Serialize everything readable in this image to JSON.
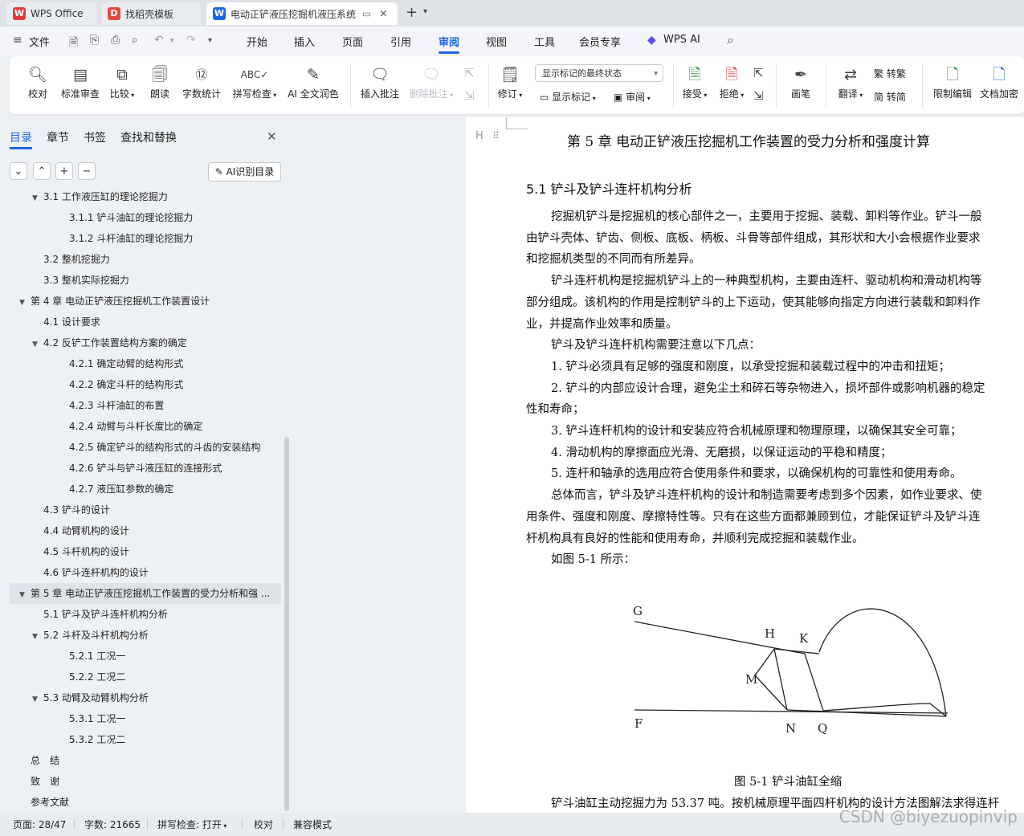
{
  "tabs": {
    "wps_office": "WPS Office",
    "template": "找稻壳模板",
    "document": "电动正铲液压挖掘机液压系统"
  },
  "menu": {
    "file": "文件",
    "items": [
      "开始",
      "插入",
      "页面",
      "引用",
      "审阅",
      "视图",
      "工具",
      "会员专享"
    ],
    "wps_ai": "WPS AI"
  },
  "ribbon": {
    "proofread": "校对",
    "standard_review": "标准审查",
    "compare": "比较",
    "read_aloud": "朗读",
    "word_count": "字数统计",
    "spell_check": "拼写检查",
    "ai_polish": "AI 全文润色",
    "insert_comment": "插入批注",
    "delete_comment": "删除批注",
    "revise": "修订",
    "markup_mode": "显示标记的最终状态",
    "show_markup": "显示标记",
    "review": "审阅",
    "accept": "接受",
    "reject": "拒绝",
    "pen": "画笔",
    "translate": "翻译",
    "to_traditional": "转繁",
    "to_simplified": "转简",
    "restrict_edit": "限制编辑",
    "doc_encrypt": "文档加密"
  },
  "sidebar": {
    "tabs": [
      "目录",
      "章节",
      "书签",
      "查找和替换"
    ],
    "ai_toc": "AI识别目录",
    "toc": [
      {
        "label": "3.1 工作液压缸的理论挖掘力",
        "level": 2,
        "arrow": "▾"
      },
      {
        "label": "3.1.1 铲斗油缸的理论挖掘力",
        "level": 3
      },
      {
        "label": "3.1.2 斗杆油缸的理论挖掘力",
        "level": 3
      },
      {
        "label": "3.2 整机挖掘力",
        "level": 2
      },
      {
        "label": "3.3 整机实际挖掘力",
        "level": 2
      },
      {
        "label": "第 4 章 电动正铲液压挖掘机工作装置设计",
        "level": 1,
        "arrow": "▾"
      },
      {
        "label": "4.1 设计要求",
        "level": 2
      },
      {
        "label": "4.2 反铲工作装置结构方案的确定",
        "level": 2,
        "arrow": "▾"
      },
      {
        "label": "4.2.1 确定动臂的结构形式",
        "level": 3
      },
      {
        "label": "4.2.2 确定斗杆的结构形式",
        "level": 3
      },
      {
        "label": "4.2.3 斗杆油缸的布置",
        "level": 3
      },
      {
        "label": "4.2.4 动臂与斗杆长度比的确定",
        "level": 3
      },
      {
        "label": "4.2.5 确定铲斗的结构形式的斗齿的安装结构",
        "level": 3
      },
      {
        "label": "4.2.6 铲斗与铲斗液压缸的连接形式",
        "level": 3
      },
      {
        "label": "4.2.7 液压缸参数的确定",
        "level": 3
      },
      {
        "label": "4.3 铲斗的设计",
        "level": 2
      },
      {
        "label": "4.4 动臂机构的设计",
        "level": 2
      },
      {
        "label": "4.5 斗杆机构的设计",
        "level": 2
      },
      {
        "label": "4.6 铲斗连杆机构的设计",
        "level": 2
      },
      {
        "label": "第 5 章 电动正铲液压挖掘机工作装置的受力分析和强 ...",
        "level": 1,
        "arrow": "▾",
        "selected": true
      },
      {
        "label": "5.1 铲斗及铲斗连杆机构分析",
        "level": 2
      },
      {
        "label": "5.2 斗杆及斗杆机构分析",
        "level": 2,
        "arrow": "▾"
      },
      {
        "label": "5.2.1 工况一",
        "level": 3
      },
      {
        "label": "5.2.2 工况二",
        "level": 3
      },
      {
        "label": "5.3 动臂及动臂机构分析",
        "level": 2,
        "arrow": "▾"
      },
      {
        "label": "5.3.1 工况一",
        "level": 3
      },
      {
        "label": "5.3.2 工况二",
        "level": 3
      },
      {
        "label": "总　结",
        "level": 1
      },
      {
        "label": "致　谢",
        "level": 1
      },
      {
        "label": "参考文献",
        "level": 1
      }
    ]
  },
  "document": {
    "chapter_title": "第 5 章  电动正铲液压挖掘机工作装置的受力分析和强度计算",
    "section_title": "5.1 铲斗及铲斗连杆机构分析",
    "lines": [
      "挖掘机铲斗是挖掘机的核心部件之一，主要用于挖掘、装载、卸料等作业。铲斗一般",
      "由铲斗壳体、铲齿、侧板、底板、柄板、斗骨等部件组成，其形状和大小会根据作业要求",
      "和挖掘机类型的不同而有所差异。",
      "铲斗连杆机构是挖掘机铲斗上的一种典型机构，主要由连杆、驱动机构和滑动机构等",
      "部分组成。该机构的作用是控制铲斗的上下运动，使其能够向指定方向进行装载和卸料作",
      "业，并提高作业效率和质量。",
      "铲斗及铲斗连杆机构需要注意以下几点：",
      "1. 铲斗必须具有足够的强度和刚度，以承受挖掘和装载过程中的冲击和扭矩；",
      "2. 铲斗的内部应设计合理，避免尘土和碎石等杂物进入，损坏部件或影响机器的稳定",
      "性和寿命；",
      "3. 铲斗连杆机构的设计和安装应符合机械原理和物理原理，以确保其安全可靠；",
      "4. 滑动机构的摩擦面应光滑、无磨损，以保证运动的平稳和精度；",
      "5. 连杆和轴承的选用应符合使用条件和要求，以确保机构的可靠性和使用寿命。",
      "总体而言，铲斗及铲斗连杆机构的设计和制造需要考虑到多个因素，如作业要求、使",
      "用条件、强度和刚度、摩擦特性等。只有在这些方面都兼顾到位，才能保证铲斗及铲斗连",
      "杆机构具有良好的性能和使用寿命，并顺利完成挖掘和装载作业。",
      "如图 5-1 所示："
    ],
    "figure_labels": [
      "G",
      "H",
      "K",
      "M",
      "F",
      "N",
      "Q"
    ],
    "figure_caption": "图 5-1 铲斗油缸全缩",
    "last_line": "铲斗油缸主动挖掘力为 53.37 吨。按机械原理平面四杆机构的设计方法图解法求得连杆"
  },
  "status": {
    "page": "页面: 28/47",
    "words": "字数: 21665",
    "spell": "拼写检查: 打开",
    "proof": "校对",
    "compat": "兼容模式"
  },
  "watermark": "CSDN @biyezuopinvip",
  "colors": {
    "accent": "#1e66e8",
    "wps_red": "#e03a3a"
  }
}
